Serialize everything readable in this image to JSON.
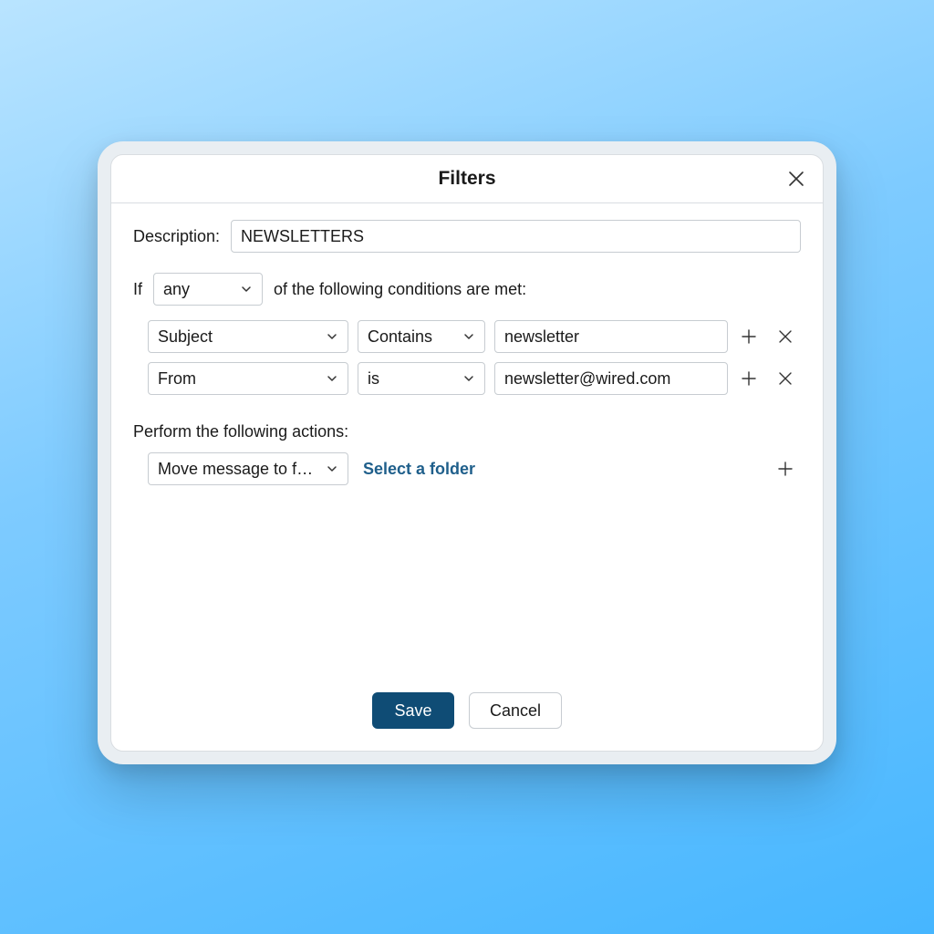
{
  "dialog": {
    "title": "Filters",
    "close_icon": "close-icon"
  },
  "description": {
    "label": "Description:",
    "value": "NEWSLETTERS"
  },
  "condition_header": {
    "prefix": "If",
    "match_mode": "any",
    "suffix": "of the following conditions are met:"
  },
  "conditions": [
    {
      "field": "Subject",
      "op": "Contains",
      "value": "newsletter"
    },
    {
      "field": "From",
      "op": "is",
      "value": "newsletter@wired.com"
    }
  ],
  "actions_header": "Perform the following actions:",
  "actions": [
    {
      "type": "Move message to fol...",
      "target_label": "Select a folder"
    }
  ],
  "buttons": {
    "save": "Save",
    "cancel": "Cancel"
  }
}
